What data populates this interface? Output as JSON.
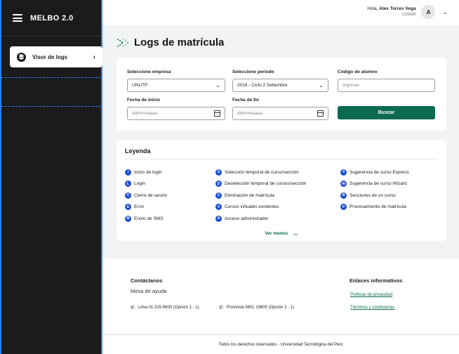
{
  "app": {
    "brand": "MELBO 2.0"
  },
  "sidebar": {
    "items": [
      {
        "label": "Visor de logs",
        "icon": "database-icon"
      }
    ]
  },
  "user": {
    "greeting": "Hola, ",
    "name": "Alex Torres Vega",
    "code": "C15220",
    "initial": "A"
  },
  "page": {
    "title": "Logs de matrícula"
  },
  "filters": {
    "empresa": {
      "label": "Seleccione empresa",
      "value": "UNUTP"
    },
    "periodo": {
      "label": "Seleccione periodo",
      "value": "2016 - Ciclo 2 Setiembre"
    },
    "codigo": {
      "label": "Código de alumno",
      "placeholder": "Ingresar"
    },
    "inicio": {
      "label": "Fecha de inicio",
      "placeholder": "dd/mm/aaaa"
    },
    "fin": {
      "label": "Fecha de fin",
      "placeholder": "dd/mm/aaaa"
    },
    "search_label": "Buscar"
  },
  "legend": {
    "title": "Leyenda",
    "columns": [
      [
        {
          "code": "I",
          "label": "Inicio de login"
        },
        {
          "code": "L",
          "label": "Login"
        },
        {
          "code": "C",
          "label": "Cierre de sesión"
        },
        {
          "code": "E",
          "label": "Error"
        },
        {
          "code": "M",
          "label": "Envío de SMS"
        }
      ],
      [
        {
          "code": "S",
          "label": "Selección temporal de curso/sección"
        },
        {
          "code": "D",
          "label": "Deselección temporal de cursos/sección"
        },
        {
          "code": "Z",
          "label": "Eliminación de matrícula"
        },
        {
          "code": "V",
          "label": "Cursos virtuales existentes"
        },
        {
          "code": "A",
          "label": "Acceso administrador"
        }
      ],
      [
        {
          "code": "X",
          "label": "Sugerencia de curso Express"
        },
        {
          "code": "W",
          "label": "Sugerencia de curso Wizard"
        },
        {
          "code": "B",
          "label": "Secciones de un curso"
        },
        {
          "code": "P",
          "label": "Procesamiento de matrícula"
        }
      ]
    ],
    "toggle_label": "Ver menos"
  },
  "footer": {
    "contact_title": "Contáctanos",
    "contact_sub": "Mesa de ayuda",
    "phone_lima": "Lima 01 315-9600 (Opción 1 - 1)",
    "phone_prov": "Provincia 0801 19600 (Opción 1 - 1)",
    "links_title": "Enlaces informativos",
    "link_privacy": "Políticas de privacidad",
    "link_terms": "Términos y condiciones",
    "copyright": "Todos los derechos reservados - Universidad Tecnológica del Perú"
  },
  "colors": {
    "accent": "#0b6a50",
    "badge": "#1e4fd6",
    "sidebar": "#1b1b1b",
    "frame": "#2f80ff"
  }
}
